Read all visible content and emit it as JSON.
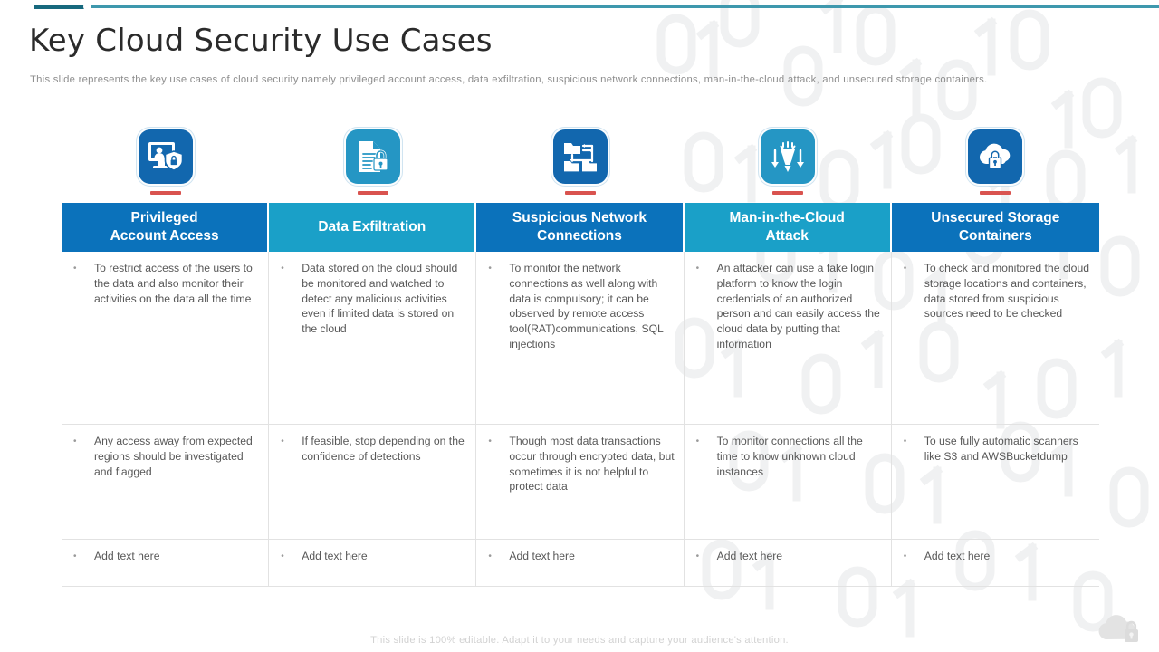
{
  "header": {
    "title": "Key Cloud Security Use Cases",
    "subtitle": "This slide represents the key use cases of cloud security namely privileged  account access, data exfiltration, suspicious network connections, man-in-the-cloud  attack, and unsecured storage containers."
  },
  "colors": {
    "header_dark_blue": "#0b72bb",
    "header_light_blue": "#1aa0c8",
    "icon_dark_blue": "#1267ae",
    "icon_light_blue": "#2596c4",
    "underline_red": "#d9534f",
    "accent_teal_dark": "#17697e",
    "accent_teal_light": "#3e98ad",
    "body_text": "#585858"
  },
  "columns": [
    {
      "title": "Privileged Account Access",
      "title_line1": "Privileged",
      "title_line2": "Account Access",
      "header_color": "#0b72bb",
      "icon": {
        "name": "monitor-user-shield-icon",
        "tile_color": "#1267ae"
      },
      "bullets": [
        "To restrict access of the users to the data and also monitor their activities on the data all the time",
        "Any access away from expected regions should be investigated and flagged",
        "Add text here"
      ]
    },
    {
      "title": "Data Exfiltration",
      "title_line1": "Data Exfiltration",
      "title_line2": "",
      "header_color": "#1aa0c8",
      "icon": {
        "name": "document-lock-icon",
        "tile_color": "#2596c4"
      },
      "bullets": [
        "Data stored on the cloud should be monitored and watched to detect any malicious activities even if limited data is stored on the cloud",
        "If feasible, stop depending on the confidence of detections",
        "Add text here"
      ]
    },
    {
      "title": "Suspicious Network Connections",
      "title_line1": "Suspicious Network",
      "title_line2": "Connections",
      "header_color": "#0b72bb",
      "icon": {
        "name": "network-folder-connections-icon",
        "tile_color": "#1267ae"
      },
      "bullets": [
        "To monitor the network connections as well  along with data is compulsory; it can be observed by remote access tool(RAT)communications, SQL injections",
        "Though most data transactions occur through encrypted data, but sometimes it is not helpful to protect data",
        "Add text here"
      ]
    },
    {
      "title": "Man-in-the-Cloud Attack",
      "title_line1": "Man-in-the-Cloud",
      "title_line2": "Attack",
      "header_color": "#1aa0c8",
      "icon": {
        "name": "virus-download-arrows-icon",
        "tile_color": "#2596c4"
      },
      "bullets": [
        "An attacker can use a fake login platform to know the login credentials of an authorized person and can easily access the cloud data by putting that information",
        "To monitor connections all the time to know unknown cloud instances",
        "Add text here"
      ]
    },
    {
      "title": "Unsecured Storage Containers",
      "title_line1": "Unsecured Storage",
      "title_line2": "Containers",
      "header_color": "#0b72bb",
      "icon": {
        "name": "cloud-lock-icon",
        "tile_color": "#1267ae"
      },
      "bullets": [
        "To check and monitored the cloud storage locations and containers, data stored from suspicious sources need to be checked",
        "To use fully automatic scanners like S3 and AWSBucketdump",
        "Add text here"
      ]
    }
  ],
  "bullet_glyph": "•",
  "footer": {
    "note": "This slide is 100% editable. Adapt it to your needs and capture your audience's attention.",
    "logo_icon": "cloud-lock-watermark-icon"
  }
}
